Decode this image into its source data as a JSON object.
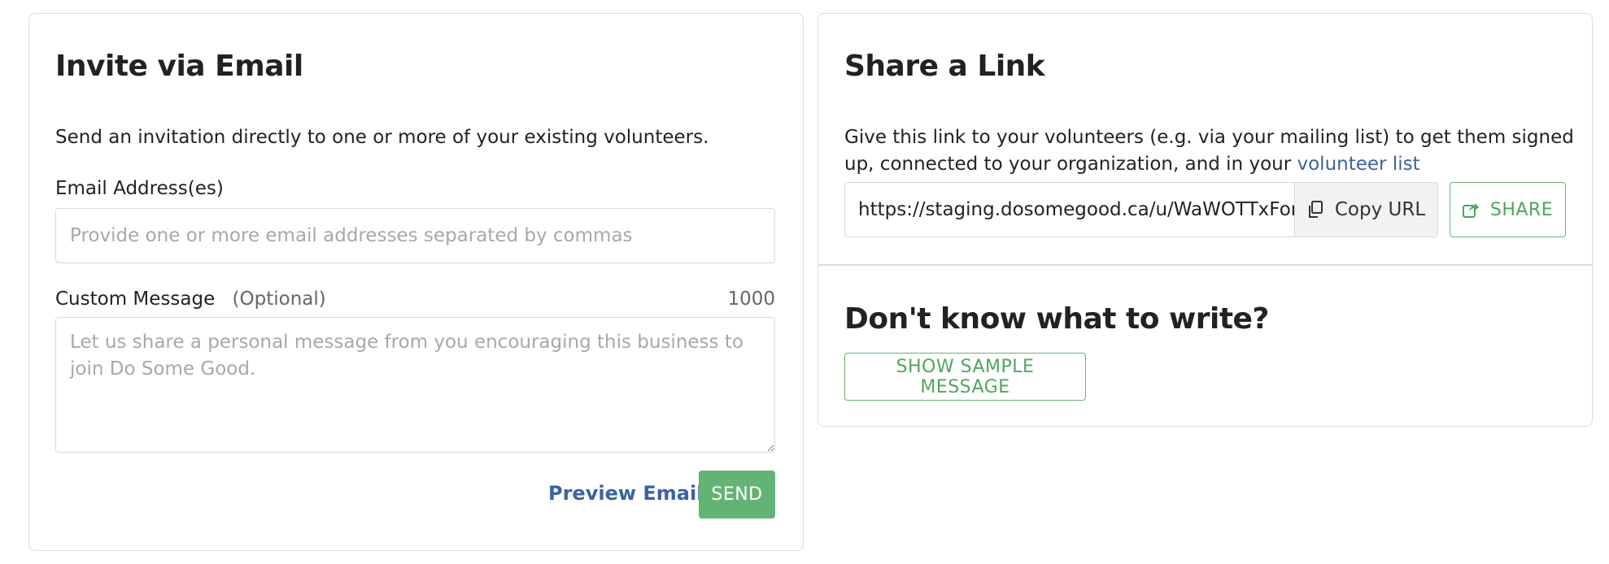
{
  "invite_email": {
    "title": "Invite via Email",
    "description": "Send an invitation directly to one or more of your existing volunteers.",
    "email_label": "Email Address(es)",
    "email_placeholder": "Provide one or more email addresses separated by commas",
    "message_label": "Custom Message",
    "message_optional": "(Optional)",
    "char_count": "1000",
    "message_placeholder": "Let us share a personal message from you encouraging this business to join Do Some Good.",
    "preview_label": "Preview Email",
    "send_label": "SEND"
  },
  "share_link": {
    "title": "Share a Link",
    "description_before": "Give this link to your volunteers (e.g. via your mailing list) to get them signed up, connected to your organization, and in your ",
    "description_link": "volunteer list",
    "url_value": "https://staging.dosomegood.ca/u/WaWOTTxFon",
    "copy_label": "Copy URL",
    "share_label": "SHARE"
  },
  "sample": {
    "title": "Don't know what to write?",
    "button_label": "SHOW SAMPLE MESSAGE"
  },
  "colors": {
    "accent_green": "#63b474",
    "link_blue": "#3a62a7",
    "border": "#dcdcdc"
  },
  "icons": {
    "copy": "copy-icon",
    "share": "share-icon",
    "resize": "resize-handle-icon"
  }
}
